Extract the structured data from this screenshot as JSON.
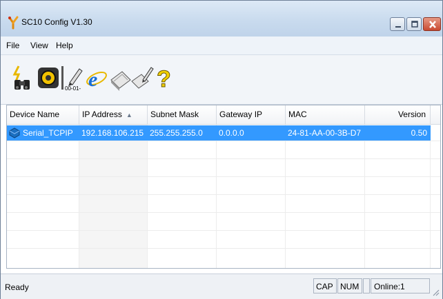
{
  "window": {
    "title": "SC10 Config V1.30",
    "buttons": [
      "minimize",
      "maximize",
      "close"
    ]
  },
  "menu": {
    "items": [
      "File",
      "View",
      "Help"
    ]
  },
  "toolbar": {
    "tools": [
      {
        "name": "search-devices",
        "icon": "binoculars-lightning-icon"
      },
      {
        "name": "configure-device",
        "icon": "gear-icon"
      },
      {
        "name": "set-mac",
        "icon": "mac-edit-icon"
      },
      {
        "name": "open-web",
        "icon": "internet-explorer-icon"
      },
      {
        "name": "firmware-upgrade",
        "icon": "chip-icon"
      },
      {
        "name": "edit-config",
        "icon": "chip-pen-icon"
      },
      {
        "name": "help",
        "icon": "question-icon"
      }
    ],
    "mac_badge": "00-01-"
  },
  "table": {
    "columns": [
      "Device Name",
      "IP Address",
      "Subnet Mask",
      "Gateway IP",
      "MAC",
      "Version"
    ],
    "sort_arrow": "▲",
    "rows": [
      {
        "device_name": "Serial_TCPIP",
        "ip_address": "192.168.106.215",
        "subnet_mask": "255.255.255.0",
        "gateway_ip": "0.0.0.0",
        "mac": "24-81-AA-00-3B-D7",
        "version": "0.50",
        "selected": true
      }
    ]
  },
  "status": {
    "text": "Ready",
    "cap": "CAP",
    "num": "NUM",
    "online": "Online:1"
  },
  "colors": {
    "selection": "#3399ff",
    "titlebar": "#c9dbee",
    "close_button": "#c94a31"
  }
}
